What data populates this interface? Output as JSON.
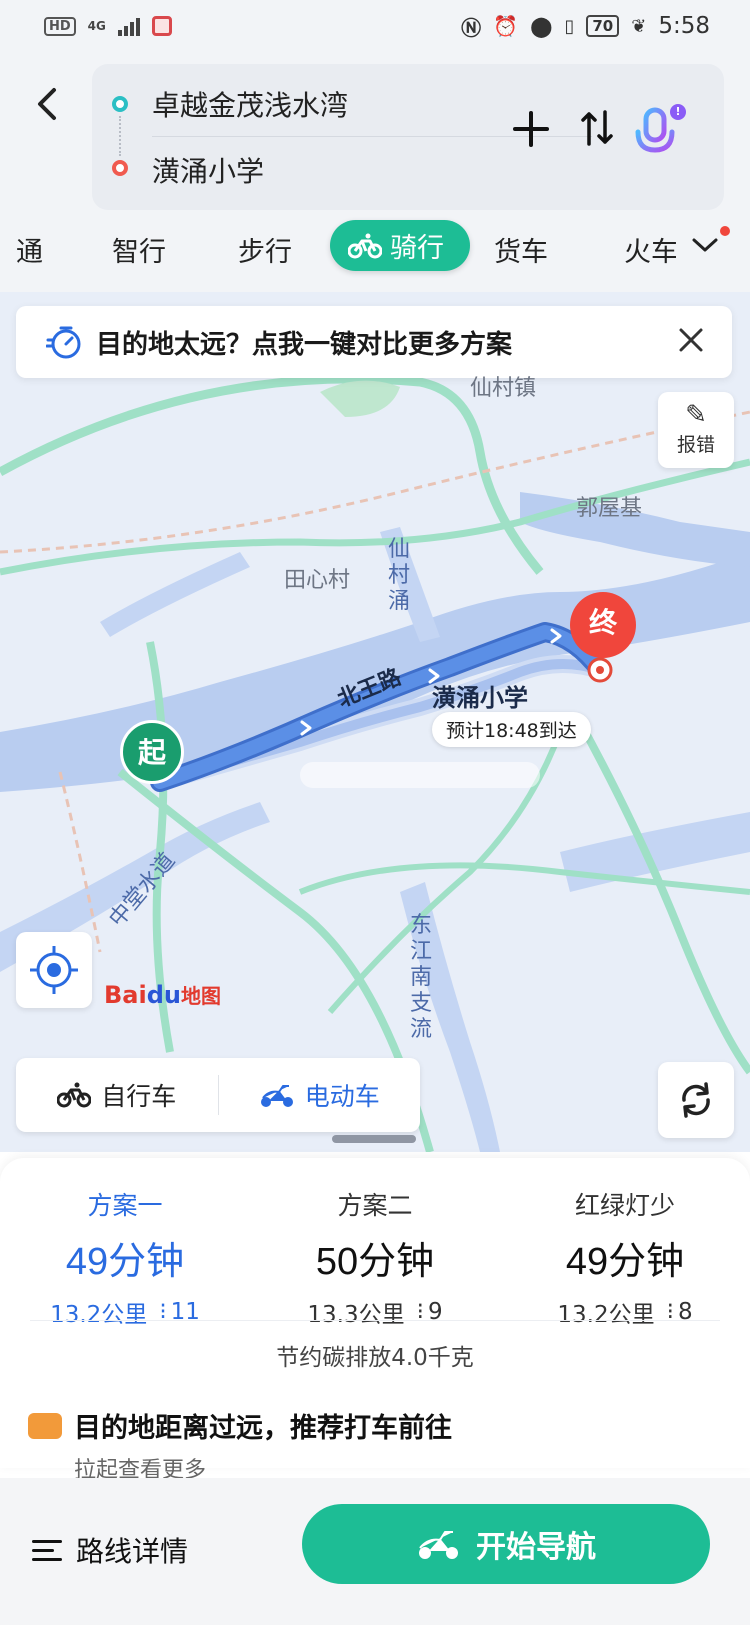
{
  "status_bar": {
    "hd_label": "HD",
    "network_label": "4G",
    "battery": "70",
    "time": "5:58"
  },
  "route": {
    "start": "卓越金茂浅水湾",
    "end": "潢涌小学"
  },
  "modes": [
    {
      "label": "通"
    },
    {
      "label": "智行"
    },
    {
      "label": "步行"
    },
    {
      "label": "骑行"
    },
    {
      "label": "货车"
    },
    {
      "label": "火车"
    }
  ],
  "map": {
    "notice_text": "目的地太远？点我一键对比更多方案",
    "report_label": "报错",
    "place_labels": {
      "xiancun": "仙村镇",
      "guowuji": "郭屋基",
      "tianxincun": "田心村",
      "xiancunyong": "仙村涌",
      "zhongtang": "中堂水道",
      "dongjiang": "东江南支流"
    },
    "road_label": "北王路",
    "destination_label": "潢涌小学",
    "eta": "预计18:48到达",
    "start_pin": "起",
    "end_pin": "终",
    "brand_bai": "Bai",
    "brand_du": "du",
    "brand_map": "地图",
    "vehicles": [
      "自行车",
      "电动车"
    ]
  },
  "plans": [
    {
      "name": "方案一",
      "time": "49分钟",
      "distance": "13.2公里",
      "lights": "11",
      "active": true
    },
    {
      "name": "方案二",
      "time": "50分钟",
      "distance": "13.3公里",
      "lights": "9",
      "active": false
    },
    {
      "name": "红绿灯少",
      "time": "49分钟",
      "distance": "13.2公里",
      "lights": "8",
      "active": false
    }
  ],
  "carbon_text": "节约碳排放4.0千克",
  "taxi": {
    "title": "目的地距离过远，推荐打车前往",
    "subtitle": "拉起查看更多"
  },
  "bottom": {
    "route_detail": "路线详情",
    "start_nav": "开始导航"
  },
  "colors": {
    "accent_green": "#1dbd95",
    "active_blue": "#2a6be0",
    "route_blue": "#5b8fe6",
    "start_pin": "#1a9d6e",
    "end_pin": "#f0463c"
  }
}
